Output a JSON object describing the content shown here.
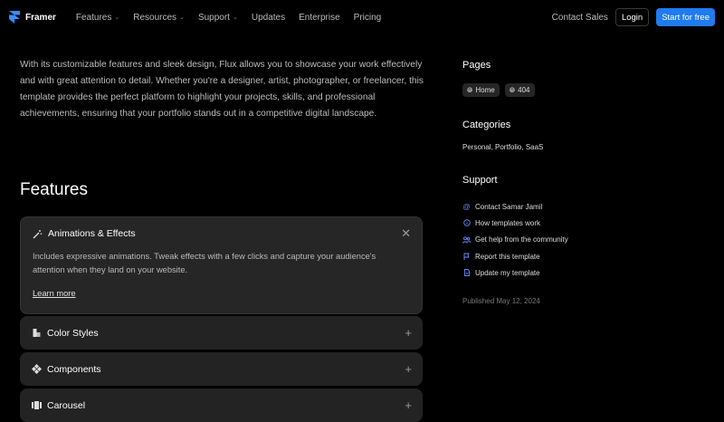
{
  "nav": {
    "brand": "Framer",
    "links": [
      {
        "label": "Features",
        "dropdown": true
      },
      {
        "label": "Resources",
        "dropdown": true
      },
      {
        "label": "Support",
        "dropdown": true
      },
      {
        "label": "Updates",
        "dropdown": false
      },
      {
        "label": "Enterprise",
        "dropdown": false
      },
      {
        "label": "Pricing",
        "dropdown": false
      }
    ],
    "contact": "Contact Sales",
    "login": "Login",
    "start": "Start for free"
  },
  "intro": "With its customizable features and sleek design, Flux allows you to showcase your work effectively and with great attention to detail. Whether you're a designer, artist, photographer, or freelancer, this template provides the perfect platform to highlight your projects, skills, and professional achievements, ensuring that your portfolio stands out in a competitive digital landscape.",
  "features": {
    "title": "Features",
    "open_item": {
      "label": "Animations & Effects",
      "icon": "magic-wand-icon",
      "body": "Includes expressive animations. Tweak effects with a few clicks and capture your audience's attention when they land on your website.",
      "link": "Learn more"
    },
    "items": [
      {
        "label": "Color Styles",
        "icon": "paint-bucket-icon"
      },
      {
        "label": "Components",
        "icon": "components-icon"
      },
      {
        "label": "Carousel",
        "icon": "carousel-icon"
      }
    ]
  },
  "sidebar": {
    "pages_title": "Pages",
    "pages": [
      "Home",
      "404"
    ],
    "categories_title": "Categories",
    "categories": "Personal, Portfolio, SaaS",
    "support_title": "Support",
    "support": [
      {
        "label": "Contact Samar Jamil",
        "icon": "at-icon"
      },
      {
        "label": "How templates work",
        "icon": "info-icon"
      },
      {
        "label": "Get help from the community",
        "icon": "community-icon"
      },
      {
        "label": "Report this template",
        "icon": "flag-icon"
      },
      {
        "label": "Update my template",
        "icon": "document-icon"
      }
    ],
    "published": "Published May 12, 2024"
  },
  "colors": {
    "accent": "#1f7bf0",
    "background": "#000000",
    "card": "#262626"
  }
}
